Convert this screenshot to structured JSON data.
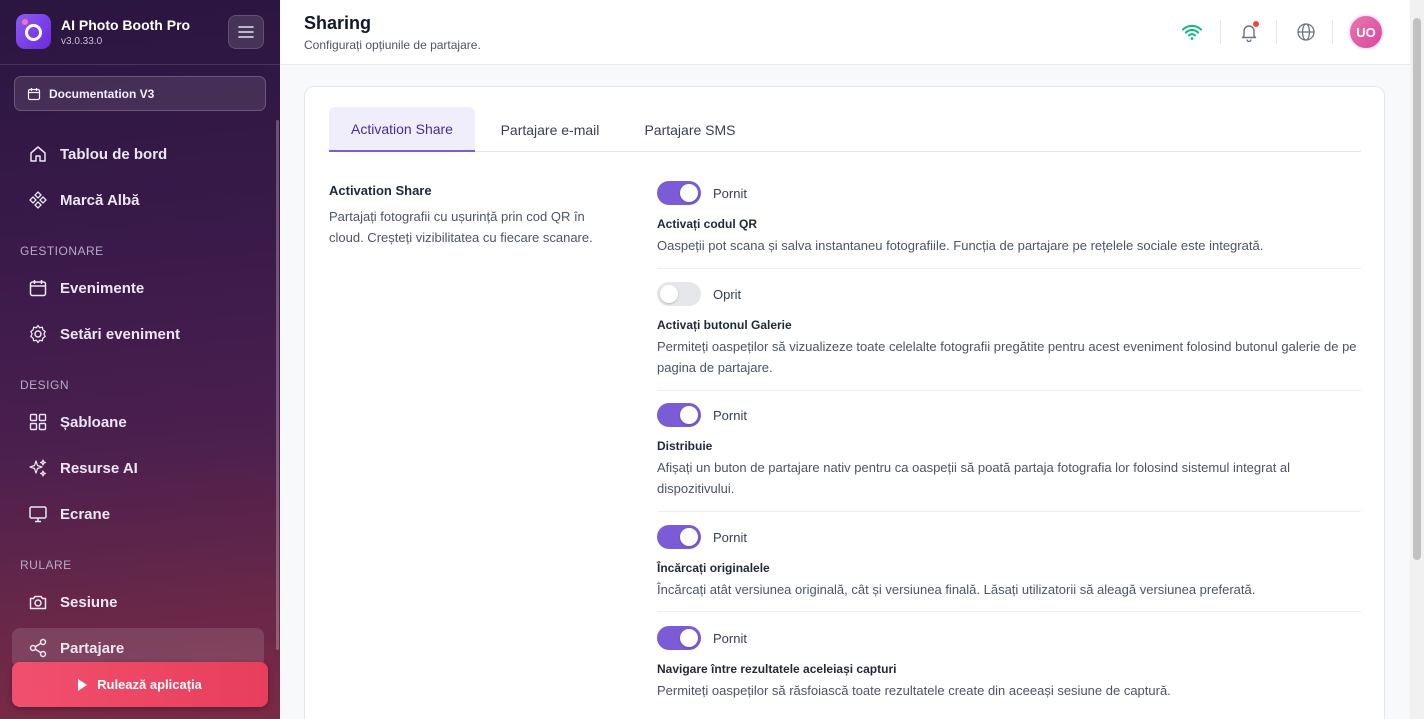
{
  "app": {
    "name": "AI Photo Booth Pro",
    "version": "v3.0.33.0"
  },
  "sidebar": {
    "doc_button": "Documentation V3",
    "items": [
      {
        "label": "Tablou de bord"
      },
      {
        "label": "Marcă Albă"
      },
      {
        "label": "Evenimente"
      },
      {
        "label": "Setări eveniment"
      },
      {
        "label": "Șabloane"
      },
      {
        "label": "Resurse AI"
      },
      {
        "label": "Ecrane"
      },
      {
        "label": "Sesiune"
      },
      {
        "label": "Partajare"
      }
    ],
    "sections": {
      "manage": "GESTIONARE",
      "design": "DESIGN",
      "run": "RULARE"
    },
    "run_button": "Rulează aplicația"
  },
  "header": {
    "title": "Sharing",
    "subtitle": "Configurați opțiunile de partajare.",
    "avatar": "UO"
  },
  "tabs": [
    {
      "label": "Activation Share"
    },
    {
      "label": "Partajare e-mail"
    },
    {
      "label": "Partajare SMS"
    }
  ],
  "section": {
    "title": "Activation Share",
    "description": "Partajați fotografii cu ușurință prin cod QR în cloud. Creșteți vizibilitatea cu fiecare scanare."
  },
  "settings": [
    {
      "state": "Pornit",
      "on": true,
      "title": "Activați codul QR",
      "description": "Oaspeții pot scana și salva instantaneu fotografiile. Funcția de partajare pe rețelele sociale este integrată."
    },
    {
      "state": "Oprit",
      "on": false,
      "title": "Activați butonul Galerie",
      "description": "Permiteți oaspeților să vizualizeze toate celelalte fotografii pregătite pentru acest eveniment folosind butonul galerie de pe pagina de partajare."
    },
    {
      "state": "Pornit",
      "on": true,
      "title": "Distribuie",
      "description": "Afișați un buton de partajare nativ pentru ca oaspeții să poată partaja fotografia lor folosind sistemul integrat al dispozitivului."
    },
    {
      "state": "Pornit",
      "on": true,
      "title": "Încărcați originalele",
      "description": "Încărcați atât versiunea originală, cât și versiunea finală. Lăsați utilizatorii să aleagă versiunea preferată."
    },
    {
      "state": "Pornit",
      "on": true,
      "title": "Navigare între rezultatele aceleiași capturi",
      "description": "Permiteți oaspeților să răsfoiască toate rezultatele create din aceeași sesiune de captură."
    }
  ],
  "colors": {
    "accent": "#7c5cd6",
    "run": "#e83e5c",
    "wifi": "#10b981"
  }
}
